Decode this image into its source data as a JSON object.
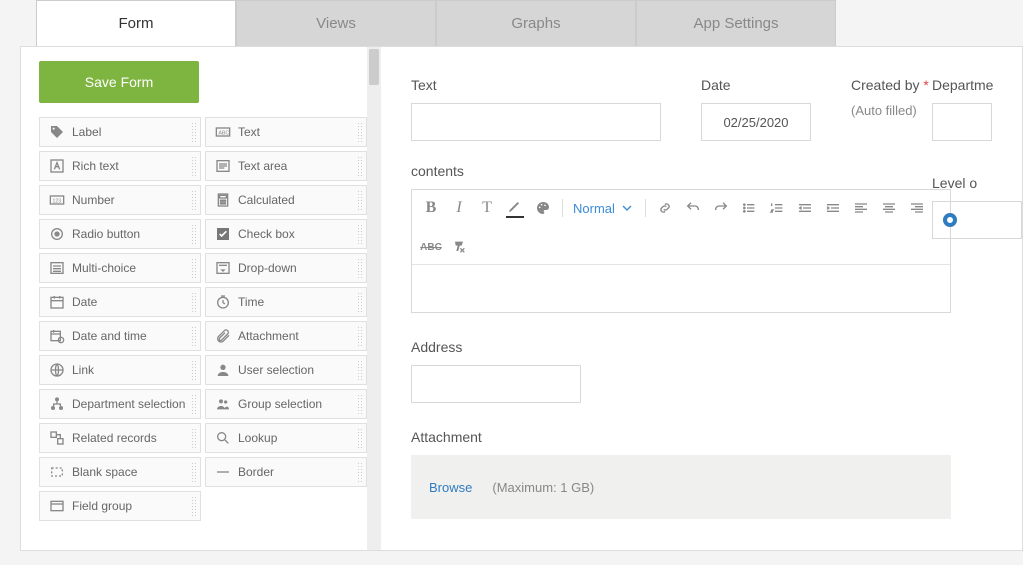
{
  "tabs": {
    "form": "Form",
    "views": "Views",
    "graphs": "Graphs",
    "settings": "App Settings"
  },
  "sidebar": {
    "save": "Save Form",
    "fields": {
      "label": "Label",
      "text": "Text",
      "richtext": "Rich text",
      "textarea": "Text area",
      "number": "Number",
      "calculated": "Calculated",
      "radio": "Radio button",
      "checkbox": "Check box",
      "multichoice": "Multi-choice",
      "dropdown": "Drop-down",
      "date": "Date",
      "time": "Time",
      "datetime": "Date and time",
      "attachment": "Attachment",
      "link": "Link",
      "userselection": "User selection",
      "deptselection": "Department selection",
      "groupselection": "Group selection",
      "related": "Related records",
      "lookup": "Lookup",
      "blank": "Blank space",
      "border": "Border",
      "fieldgroup": "Field group"
    }
  },
  "form": {
    "text_label": "Text",
    "date_label": "Date",
    "date_value": "02/25/2020",
    "createdby_label": "Created by",
    "autofilled": "(Auto filled)",
    "department_label": "Departme",
    "contents_label": "contents",
    "level_label": "Level o",
    "address_label": "Address",
    "attachment_label": "Attachment",
    "browse": "Browse",
    "maxsize": "(Maximum: 1 GB)"
  },
  "rte": {
    "normal": "Normal"
  }
}
